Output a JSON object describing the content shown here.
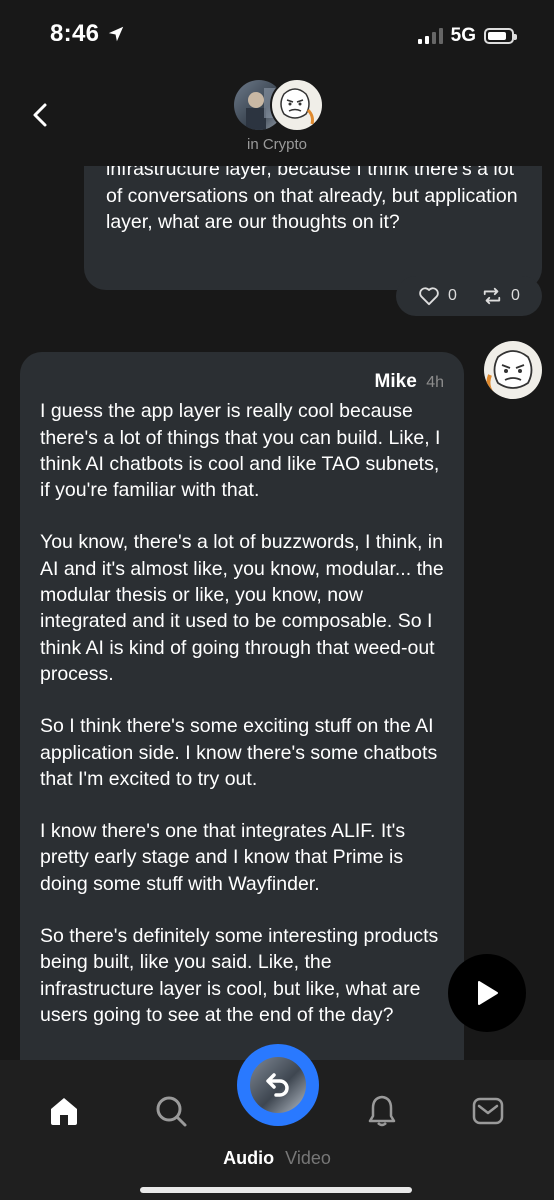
{
  "status_bar": {
    "time": "8:46",
    "network": "5G",
    "battery_level": 0.8
  },
  "header": {
    "room_label": "in Crypto"
  },
  "my_message": {
    "text": "infrastructure layer, because I think there's a lot of conversations on that already, but application layer, what are our thoughts on it?"
  },
  "reactions": {
    "likes": "0",
    "reposts": "0"
  },
  "mike_message": {
    "sender": "Mike",
    "time": "4h",
    "paragraphs": [
      "I guess the app layer is really cool because there's a lot of things that you can build. Like, I think AI chatbots is cool and like TAO subnets, if you're familiar with that.",
      "You know, there's a lot of buzzwords, I think, in AI and it's almost like, you know, modular... the modular thesis or like, you know, now integrated and it used to be composable. So I think AI is kind of going through that weed-out process.",
      "So I think there's some exciting stuff on the AI application side. I know there's some chatbots that I'm excited to try out.",
      "I know there's one that integrates ALIF. It's pretty early stage and I know that Prime is doing some stuff with Wayfinder.",
      "So there's definitely some interesting products being built, like you said. Like, the infrastructure layer is cool, but like, what are users going to see at the end of the day?"
    ]
  },
  "bottom_nav": {
    "audio_label": "Audio",
    "video_label": "Video"
  },
  "icons": [
    "location-arrow-icon",
    "back-chevron-icon",
    "heart-icon",
    "repost-icon",
    "play-icon",
    "home-icon",
    "search-icon",
    "bell-icon",
    "inbox-icon"
  ],
  "colors": {
    "background": "#181818",
    "bubble": "#2b2f33",
    "accent": "#2979ff"
  }
}
